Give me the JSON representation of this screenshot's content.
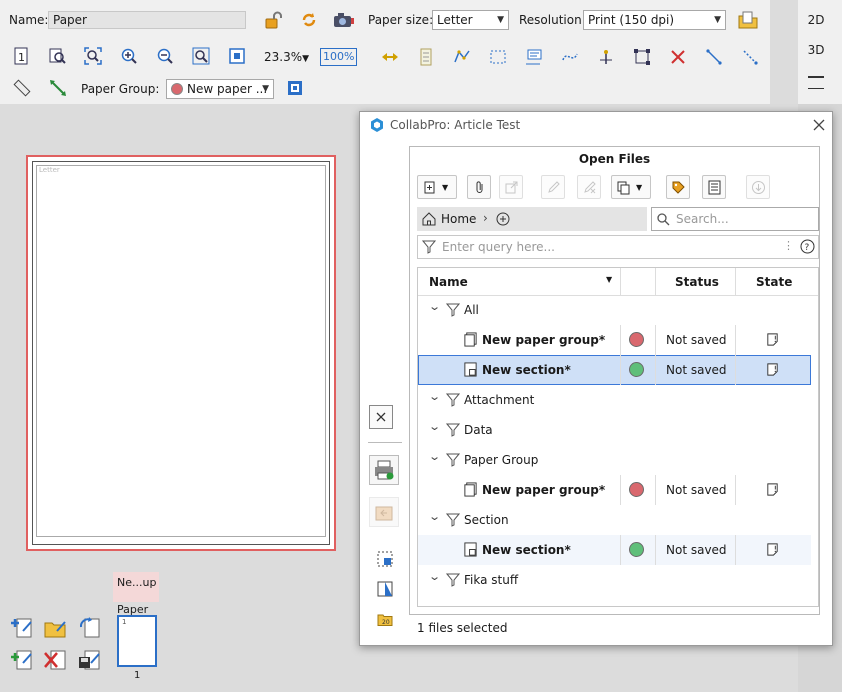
{
  "toolbar": {
    "name_label": "Name:",
    "name_value": "Paper",
    "paper_size_label": "Paper size:",
    "paper_size_value": "Letter",
    "resolution_label": "Resolution:",
    "resolution_value": "Print (150 dpi)",
    "zoom_value": "23.3%",
    "zoom_100": "100%",
    "paper_group_label": "Paper Group:",
    "paper_group_value": "New paper ..."
  },
  "view_modes": {
    "mode_2d": "2D",
    "mode_3d": "3D"
  },
  "page": {
    "paper_label": "Letter"
  },
  "thumbnails": {
    "group_label": "Ne...up",
    "paper_label": "Paper",
    "thumb_number": "1",
    "page_number": "1"
  },
  "dialog": {
    "title": "CollabPro: Article Test",
    "panel_title": "Open Files",
    "breadcrumb_home": "Home",
    "search_placeholder": "Search...",
    "query_placeholder": "Enter query here...",
    "columns": {
      "name": "Name",
      "status": "Status",
      "state": "State"
    },
    "groups": [
      {
        "label": "All",
        "items": [
          {
            "name": "New paper group*",
            "status": "Not saved",
            "color": "#d9686e",
            "kind": "paper"
          },
          {
            "name": "New section*",
            "status": "Not saved",
            "color": "#5fbf7a",
            "kind": "section",
            "selected": true
          }
        ]
      },
      {
        "label": "Attachment",
        "items": []
      },
      {
        "label": "Data",
        "items": []
      },
      {
        "label": "Paper Group",
        "items": [
          {
            "name": "New paper group*",
            "status": "Not saved",
            "color": "#d9686e",
            "kind": "paper"
          }
        ]
      },
      {
        "label": "Section",
        "items": [
          {
            "name": "New section*",
            "status": "Not saved",
            "color": "#5fbf7a",
            "kind": "section"
          }
        ]
      },
      {
        "label": "Fika stuff",
        "items": []
      }
    ],
    "footer_status": "1 files selected"
  },
  "colors": {
    "accent_blue": "#2b6fc7",
    "selection": "#cfe0f7",
    "paper_group_red": "#d9686e",
    "section_green": "#5fbf7a"
  }
}
